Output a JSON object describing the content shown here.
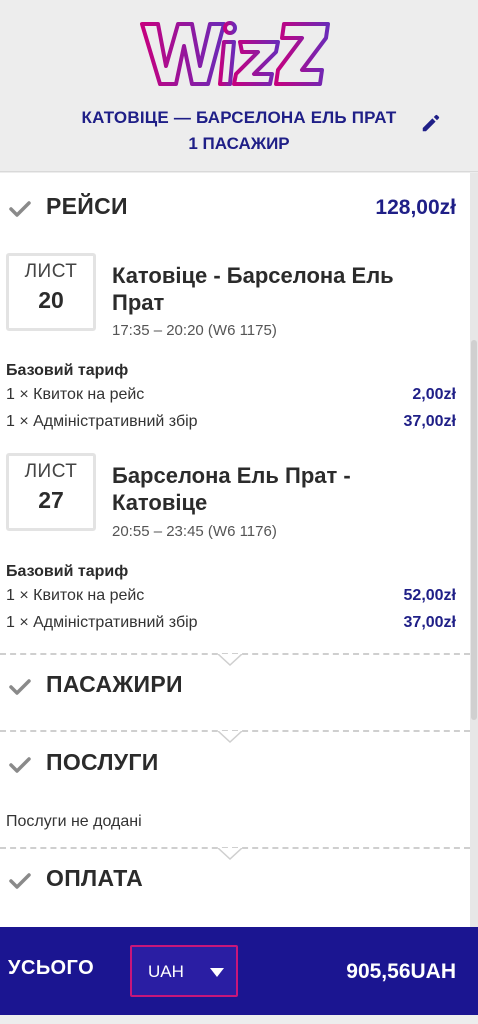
{
  "brand": {
    "logo_text": "Wizz",
    "primary_color": "#1f1f87",
    "accent_color": "#c8167a"
  },
  "header": {
    "route": "КАТОВІЦЕ — БАРСЕЛОНА ЕЛЬ ПРАТ",
    "passengers": "1 ПАСАЖИР",
    "edit_icon": "pencil-icon"
  },
  "flights_section": {
    "title": "РЕЙСИ",
    "total": "128,00zł",
    "flights": [
      {
        "month": "ЛИСТ",
        "day": "20",
        "route_line1": "Катовіце - Барселона Ель",
        "route_line2": "Прат",
        "time": "17:35 – 20:20 (W6 1175)",
        "fare_title": "Базовий тариф",
        "fares": [
          {
            "label": "1 × Квиток на рейс",
            "price": "2,00zł"
          },
          {
            "label": "1 × Адміністративний збір",
            "price": "37,00zł"
          }
        ]
      },
      {
        "month": "ЛИСТ",
        "day": "27",
        "route_line1": "Барселона Ель Прат -",
        "route_line2": "Катовіце",
        "time": "20:55 – 23:45 (W6 1176)",
        "fare_title": "Базовий тариф",
        "fares": [
          {
            "label": "1 × Квиток на рейс",
            "price": "52,00zł"
          },
          {
            "label": "1 × Адміністративний збір",
            "price": "37,00zł"
          }
        ]
      }
    ]
  },
  "passengers_section": {
    "title": "ПАСАЖИРИ"
  },
  "services_section": {
    "title": "ПОСЛУГИ",
    "empty_text": "Послуги не додані"
  },
  "payment_section": {
    "title": "ОПЛАТА"
  },
  "footer": {
    "label": "УСЬОГО",
    "currency": "UAH",
    "total": "905,56UAH"
  }
}
